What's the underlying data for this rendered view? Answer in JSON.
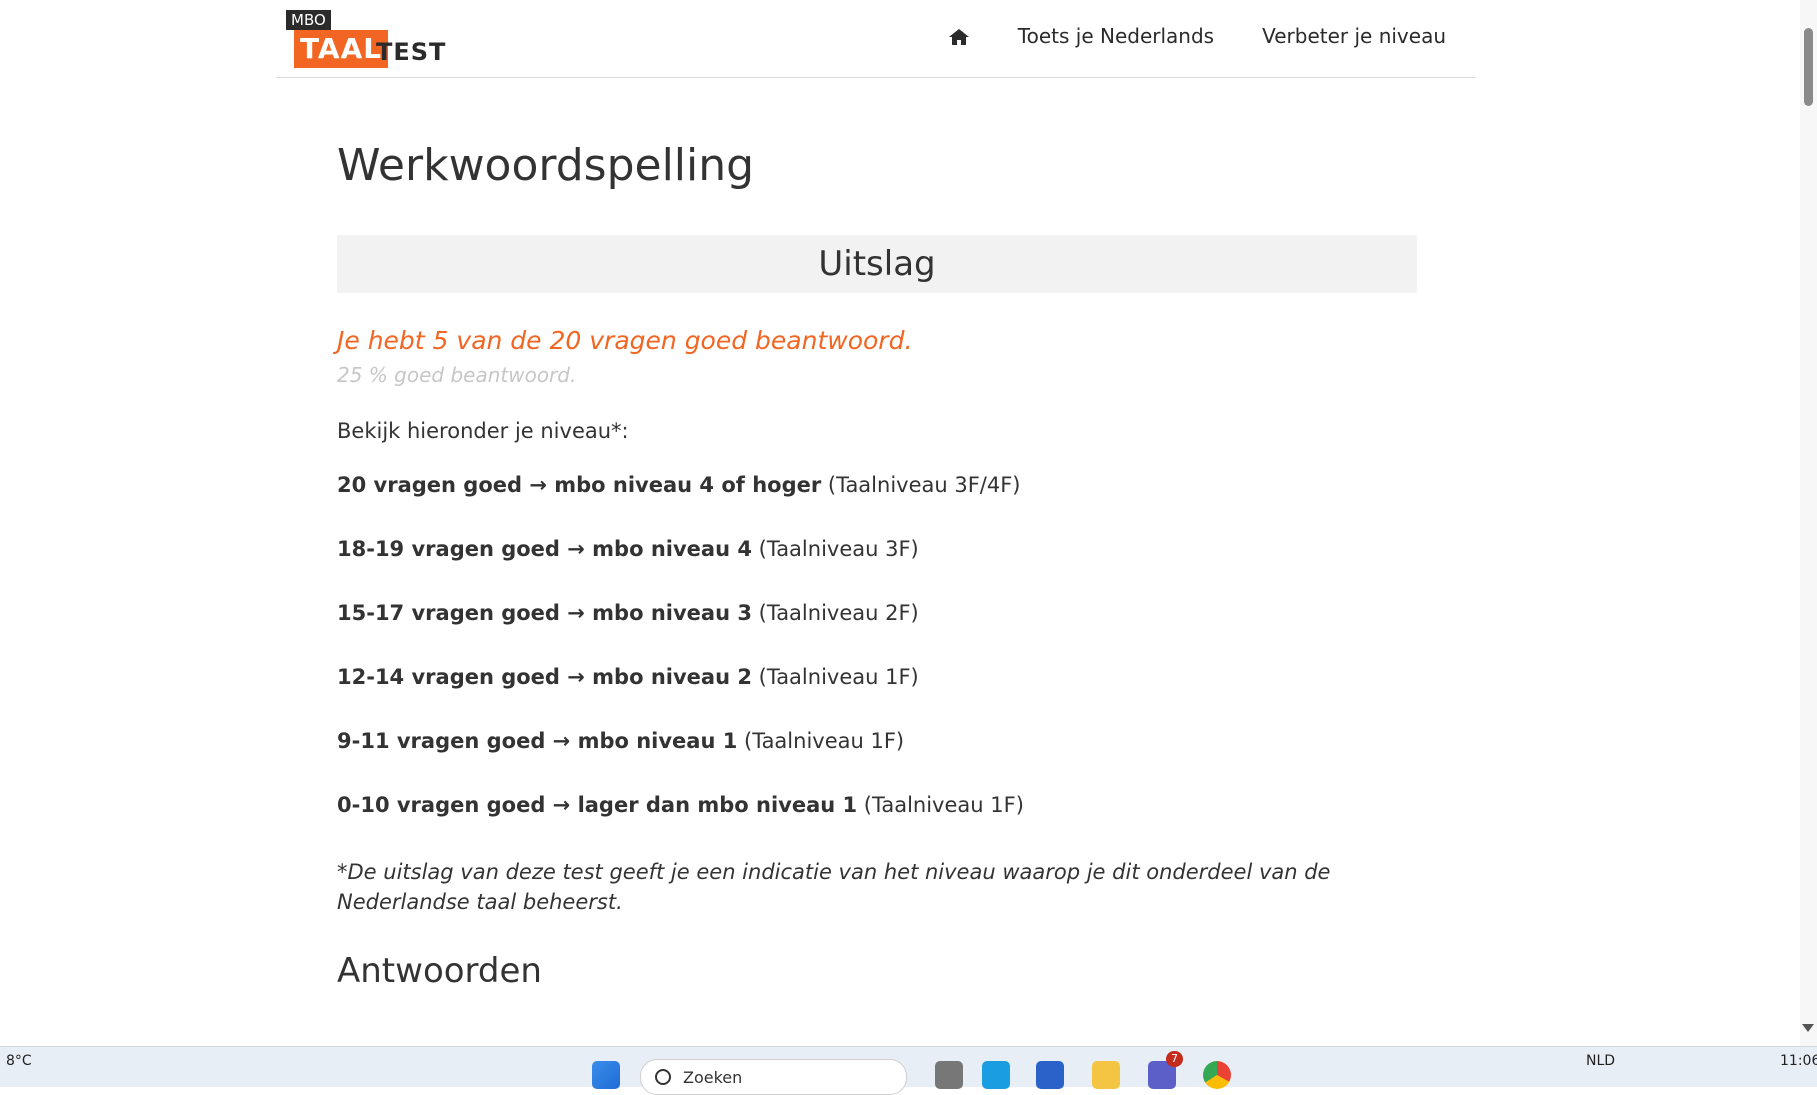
{
  "header": {
    "logo": {
      "mbo": "MBO",
      "taal": "TAAL",
      "test": "TEST"
    },
    "nav": [
      {
        "label": "Toets je Nederlands"
      },
      {
        "label": "Verbeter je niveau"
      }
    ]
  },
  "main": {
    "title": "Werkwoordspelling",
    "result_heading": "Uitslag",
    "score": "Je hebt 5 van de 20 vragen goed beantwoord.",
    "percent": "25 % goed beantwoord.",
    "intro": "Bekijk hieronder je niveau*:",
    "levels": [
      {
        "bold": "20 vragen goed → mbo niveau 4 of hoger",
        "normal": " (Taalniveau 3F/4F)"
      },
      {
        "bold": "18-19 vragen goed → mbo niveau 4",
        "normal": " (Taalniveau 3F)"
      },
      {
        "bold": "15-17 vragen goed → mbo niveau 3",
        "normal": " (Taalniveau 2F)"
      },
      {
        "bold": "12-14 vragen goed → mbo niveau 2",
        "normal": " (Taalniveau 1F)"
      },
      {
        "bold": "9-11 vragen goed → mbo niveau 1",
        "normal": " (Taalniveau 1F)"
      },
      {
        "bold": "0-10 vragen goed → lager dan mbo niveau 1",
        "normal": " (Taalniveau 1F)"
      }
    ],
    "note": "*De uitslag van deze test geeft je een indicatie van het niveau waarop je dit onderdeel van de Nederlandse taal beheerst.",
    "answers_heading": "Antwoorden"
  },
  "taskbar": {
    "temperature": "8°C",
    "search_placeholder": "Zoeken",
    "teams_badge": "7",
    "language": "NLD",
    "time": "11:06"
  },
  "colors": {
    "accent": "#f26522",
    "muted": "#c7c7c7",
    "bar": "#f2f2f2"
  }
}
